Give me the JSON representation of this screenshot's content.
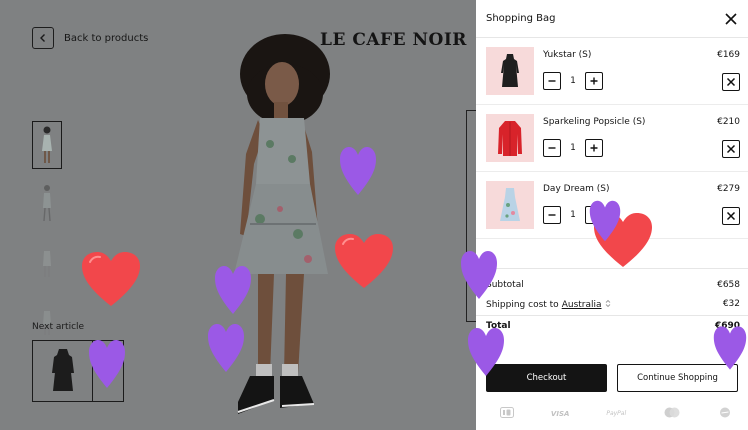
{
  "product_page": {
    "back_label": "Back to products",
    "brand": "LE CAFE NOIR",
    "next_article_label": "Next article"
  },
  "bag": {
    "title": "Shopping Bag",
    "items": [
      {
        "name": "Yukstar (S)",
        "price": "€169",
        "quantity": "1",
        "color": "#1f1f1f"
      },
      {
        "name": "Sparkeling Popsicle (S)",
        "price": "€210",
        "quantity": "1",
        "color": "#d8232a"
      },
      {
        "name": "Day Dream (S)",
        "price": "€279",
        "quantity": "1",
        "color": "#b9d3e6"
      }
    ],
    "subtotal_label": "Subtotal",
    "subtotal_value": "€658",
    "shipping_label": "Shipping cost to",
    "shipping_country": "Australia",
    "shipping_value": "€32",
    "total_label": "Total",
    "total_value": "€690",
    "checkout_label": "Checkout",
    "continue_label": "Continue Shopping",
    "payment_methods": [
      "iDEAL",
      "VISA",
      "PayPal",
      "mastercard",
      "AMEX"
    ]
  },
  "colors": {
    "overlay": "#7f8182",
    "heart_red": "#f2474b",
    "heart_purple": "#9b59e6",
    "item_bg": "#f7dada"
  }
}
